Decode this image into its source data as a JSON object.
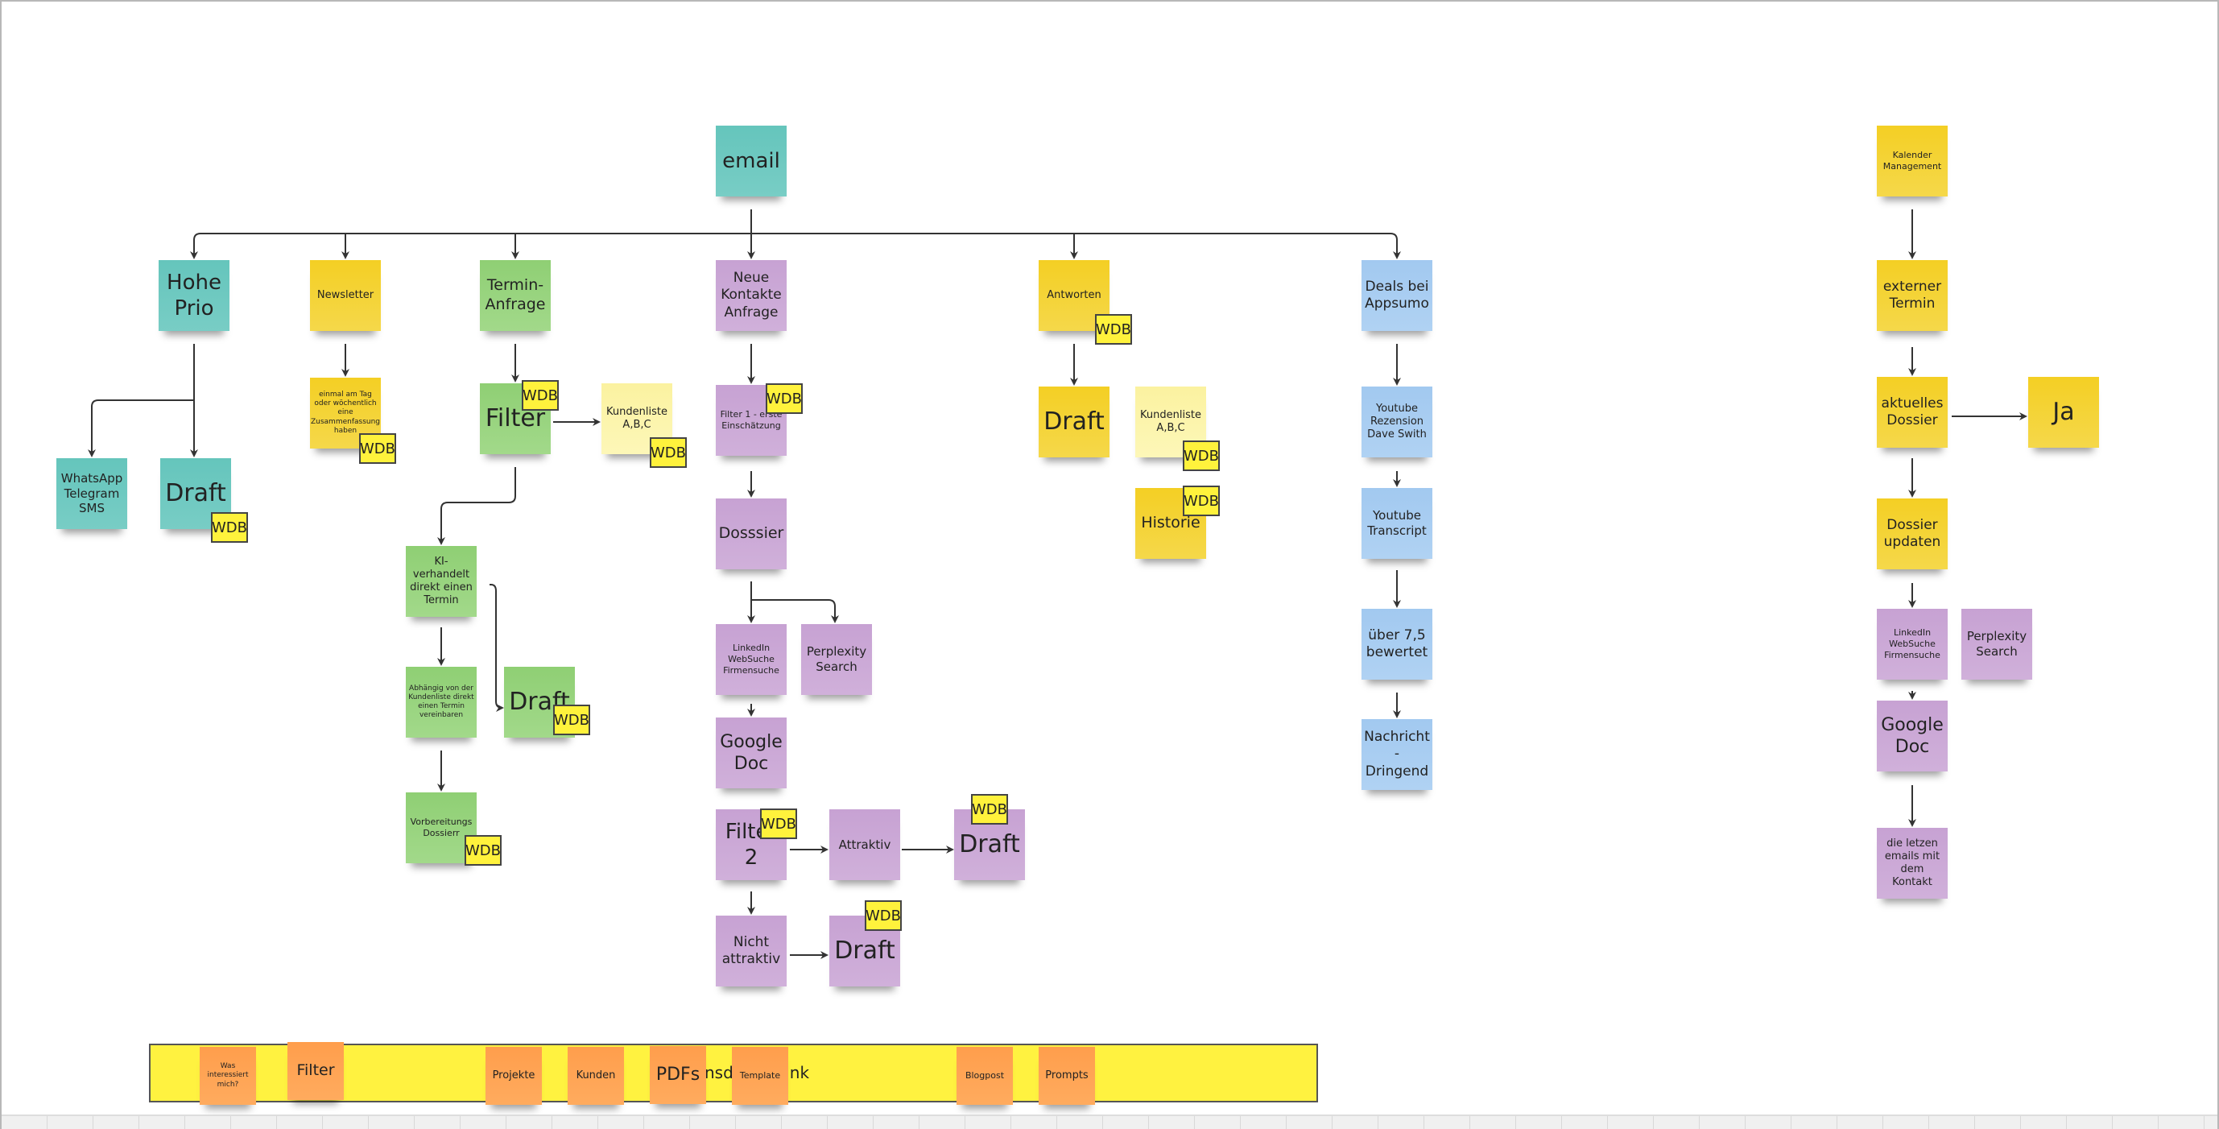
{
  "board": {
    "root": "email",
    "branches": {
      "hohe_prio": {
        "title": "Hohe Prio",
        "channels": "WhatsApp Telegram SMS",
        "draft": "Draft",
        "badge": "WDB"
      },
      "newsletter": {
        "title": "Newsletter",
        "summary": "einmal am Tag oder wöchentlich eine Zusammenfassung haben",
        "badge": "WDB"
      },
      "termin": {
        "title": "Termin-Anfrage",
        "filter": "Filter",
        "filter_badge": "WDB",
        "kundenliste": "Kundenliste A,B,C",
        "kundenliste_badge": "WDB",
        "ki": "KI-verhandelt direkt einen Termin",
        "abhaengig": "Abhängig von der Kundenliste direkt einen Termin vereinbaren",
        "draft": "Draft",
        "draft_badge": "WDB",
        "vorbereitung": "Vorbereitungs Dossierr",
        "vorbereitung_badge": "WDB"
      },
      "kontakte": {
        "title": "Neue Kontakte Anfrage",
        "filter1": "Filter 1 - erste Einschätzung",
        "filter1_badge": "WDB",
        "dossier": "Dosssier",
        "linkedin": "LinkedIn WebSuche Firmensuche",
        "perplexity": "Perplexity Search",
        "google_doc": "Google Doc",
        "filter2": "Filter 2",
        "filter2_badge": "WDB",
        "attraktiv": "Attraktiv",
        "draft_a": "Draft",
        "draft_a_badge": "WDB",
        "nicht": "Nicht attraktiv",
        "draft_n": "Draft",
        "draft_n_badge": "WDB"
      },
      "antworten": {
        "title": "Antworten",
        "badge": "WDB",
        "draft": "Draft",
        "kundenliste": "Kundenliste A,B,C",
        "kundenliste_badge": "WDB",
        "historie": "Historie",
        "historie_badge": "WDB"
      },
      "deals": {
        "title": "Deals bei Appsumo",
        "rezension": "Youtube Rezension Dave Swith",
        "transcript": "Youtube Transcript",
        "bewertet": "über 7,5 bewertet",
        "nachricht": "Nachricht - Dringend"
      }
    },
    "kalender": {
      "title": "Kalender Management",
      "extern": "externer Termin",
      "aktuell": "aktuelles Dossier",
      "ja": "Ja",
      "update": "Dossier updaten",
      "linkedin": "LinkedIn WebSuche Firmensuche",
      "perplexity": "Perplexity Search",
      "google_doc": "Google Doc",
      "emails": "die letzen emails mit dem Kontakt"
    },
    "knowledge_bar": {
      "title": "Wissensdatenbank",
      "items": [
        "Was interessiert mich?",
        "Filter",
        "Projekte",
        "Kunden",
        "PDFs",
        "Template",
        "Blogpost",
        "Prompts"
      ]
    }
  },
  "colors": {
    "teal": "#6cc8bf",
    "yellow": "#f5d128",
    "green": "#93d07a",
    "purple": "#c8a4d4",
    "blue": "#a6ccf2",
    "light_yellow": "#fcf4aa",
    "orange": "#ffa152",
    "wdb_badge": "#fff23c"
  }
}
